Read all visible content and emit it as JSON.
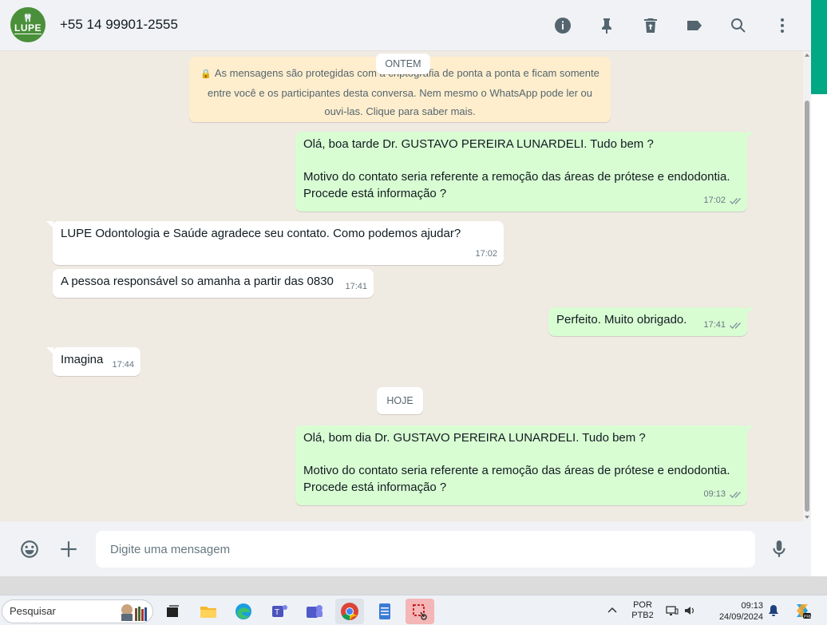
{
  "header": {
    "avatar_text": "LUPE",
    "contact_name": "+55 14 99901-2555",
    "icons": [
      "info-icon",
      "pin-icon",
      "delete-icon",
      "label-icon",
      "search-icon",
      "more-icon"
    ]
  },
  "chat": {
    "notice": "As mensagens são protegidas com a criptografia de ponta a ponta e ficam somente entre você e os participantes desta conversa. Nem mesmo o WhatsApp pode ler ou ouvi-las. Clique para saber mais.",
    "date_ontem": "ONTEM",
    "date_hoje": "HOJE",
    "messages": [
      {
        "dir": "out",
        "text": "Olá, boa tarde Dr. GUSTAVO PEREIRA LUNARDELI. Tudo bem ?\n\nMotivo do contato seria referente a remoção das áreas de prótese e endodontia. Procede está informação ?",
        "time": "17:02",
        "read": true
      },
      {
        "dir": "in",
        "text": "LUPE Odontologia e Saúde agradece seu contato. Como podemos ajudar?",
        "time": "17:02"
      },
      {
        "dir": "in",
        "text": "A pessoa responsável so amanha a partir das 0830",
        "time": "17:41"
      },
      {
        "dir": "out",
        "text": "Perfeito. Muito obrigado.",
        "time": "17:41",
        "read": true
      },
      {
        "dir": "in",
        "text": "Imagina",
        "time": "17:44"
      },
      {
        "dir": "out",
        "text": "Olá, bom dia Dr. GUSTAVO PEREIRA LUNARDELI. Tudo bem ?\n\nMotivo do contato seria referente a remoção das áreas de prótese e endodontia. Procede está informação ?",
        "time": "09:13",
        "read": true
      }
    ]
  },
  "composer": {
    "placeholder": "Digite uma mensagem"
  },
  "taskbar": {
    "search_label": "Pesquisar",
    "lang_top": "POR",
    "lang_bottom": "PTB2",
    "time": "09:13",
    "date": "24/09/2024"
  },
  "colors": {
    "accent": "#00a884",
    "outgoing_bubble": "#d9fdd3",
    "incoming_bubble": "#ffffff",
    "chat_background": "#efeae2",
    "notice_background": "#ffeecd"
  }
}
